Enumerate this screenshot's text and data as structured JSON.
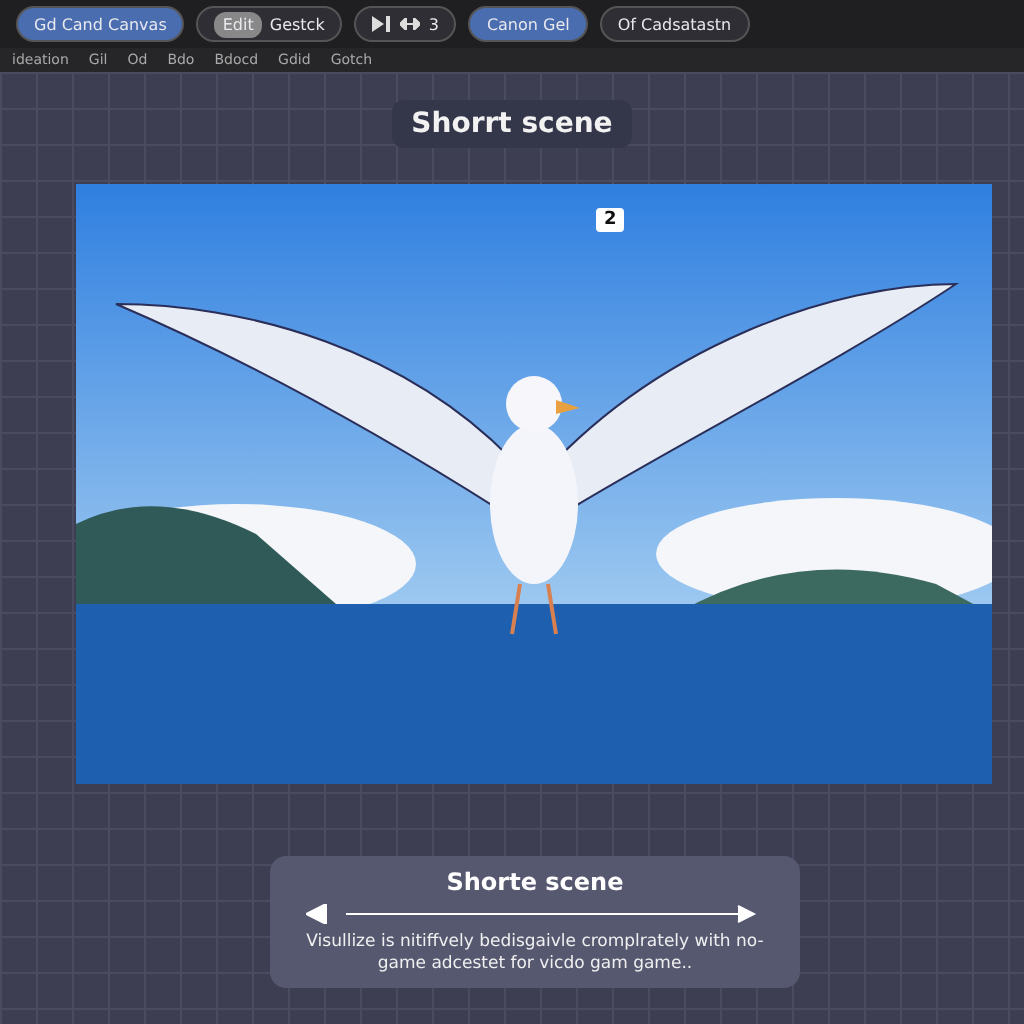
{
  "toolbar": {
    "groups": [
      {
        "kind": "pill",
        "label": "Gd Cand Canvas",
        "selected": true
      },
      {
        "kind": "split",
        "label": "Edit",
        "secondary": "Gestck",
        "selected": false
      },
      {
        "kind": "play",
        "secondary": "3",
        "selected": false
      },
      {
        "kind": "pill",
        "label": "Canon Gel",
        "selected": true
      },
      {
        "kind": "pill",
        "label": "Of Cadsatastn",
        "selected": false
      }
    ]
  },
  "subtoolbar": {
    "items": [
      "ideation",
      "Gil",
      "Od",
      "Bdo",
      "Bdocd",
      "Gdid",
      "Gotch"
    ]
  },
  "canvas": {
    "title": "Shorrt scene",
    "frame_marker": "2"
  },
  "caption": {
    "title": "Shorte scene",
    "text": "Visullize is nitiffvely bedisgaivle cromplrately with no-game adcestet for vicdo gam game.."
  }
}
